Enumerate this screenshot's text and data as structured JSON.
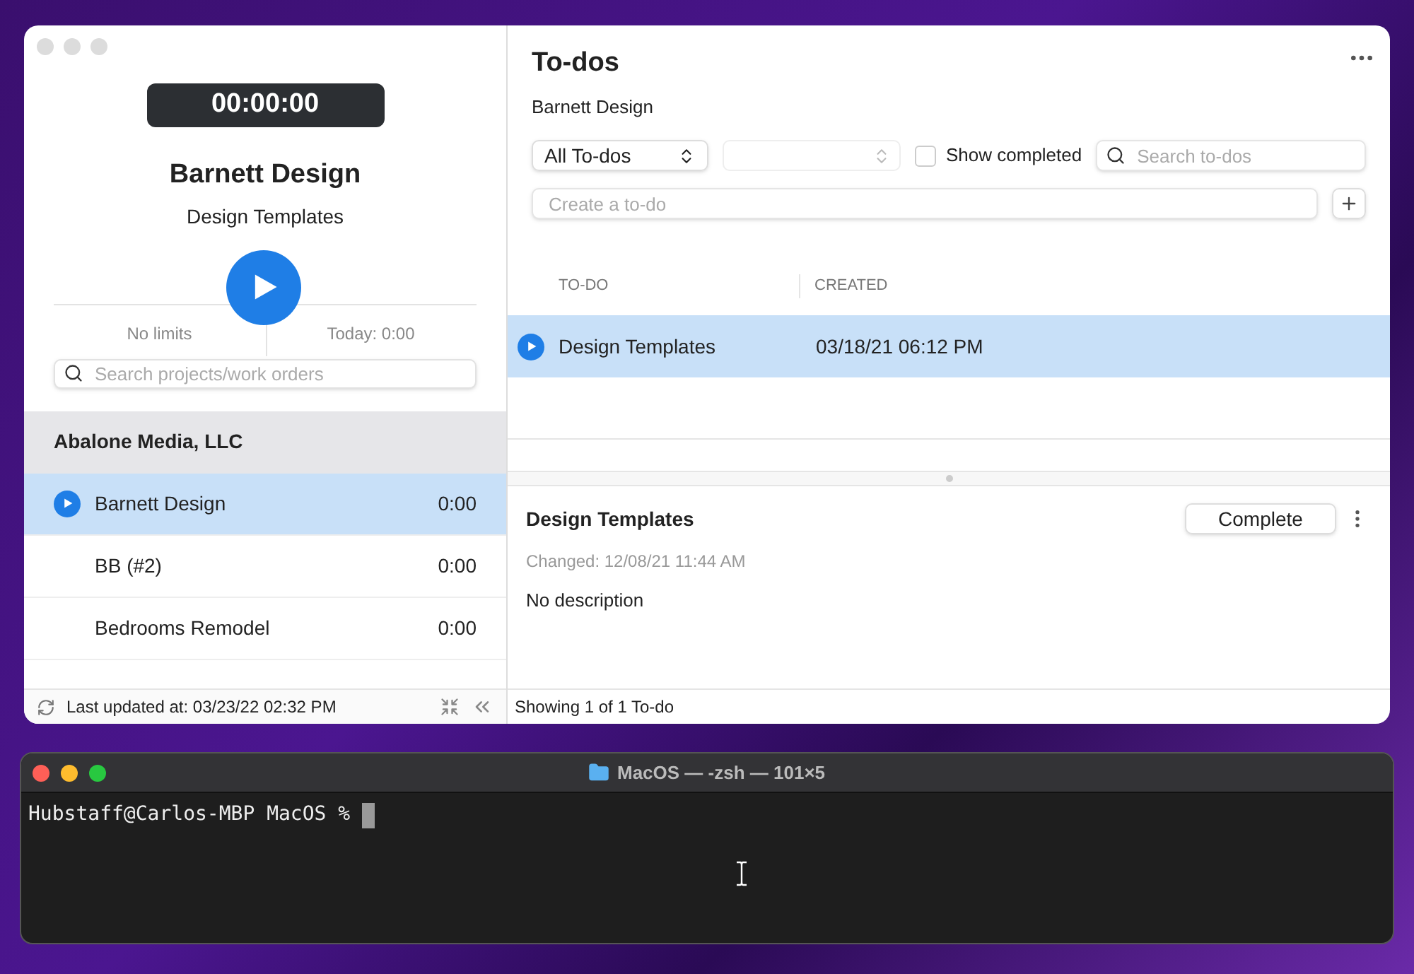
{
  "app": {
    "timer": "00:00:00",
    "project_title": "Barnett Design",
    "task_title": "Design Templates",
    "limits": "No limits",
    "today": "Today: 0:00",
    "search": {
      "placeholder": "Search projects/work orders"
    },
    "client": "Abalone Media, LLC",
    "projects": [
      {
        "name": "Barnett Design",
        "time": "0:00",
        "selected": true
      },
      {
        "name": "BB (#2)",
        "time": "0:00",
        "selected": false
      },
      {
        "name": "Bedrooms Remodel",
        "time": "0:00",
        "selected": false
      }
    ],
    "footer": "Last updated at: 03/23/22 02:32 PM"
  },
  "todos": {
    "title": "To-dos",
    "subtitle": "Barnett Design",
    "filter": "All To-dos",
    "show_completed": {
      "label": "Show completed",
      "checked": false
    },
    "search": {
      "placeholder": "Search to-dos"
    },
    "create": {
      "placeholder": "Create a to-do"
    },
    "table": {
      "columns": [
        "TO-DO",
        "CREATED"
      ],
      "rows": [
        {
          "todo": "Design Templates",
          "created": "03/18/21 06:12 PM",
          "selected": true
        }
      ]
    },
    "detail": {
      "title": "Design Templates",
      "button": "Complete",
      "changed": "Changed: 12/08/21 11:44 AM",
      "description": "No description"
    },
    "status": "Showing 1 of 1 To-do"
  },
  "terminal": {
    "title": "MacOS — -zsh — 101×5",
    "prompt": "Hubstaff@Carlos-MBP MacOS %"
  }
}
